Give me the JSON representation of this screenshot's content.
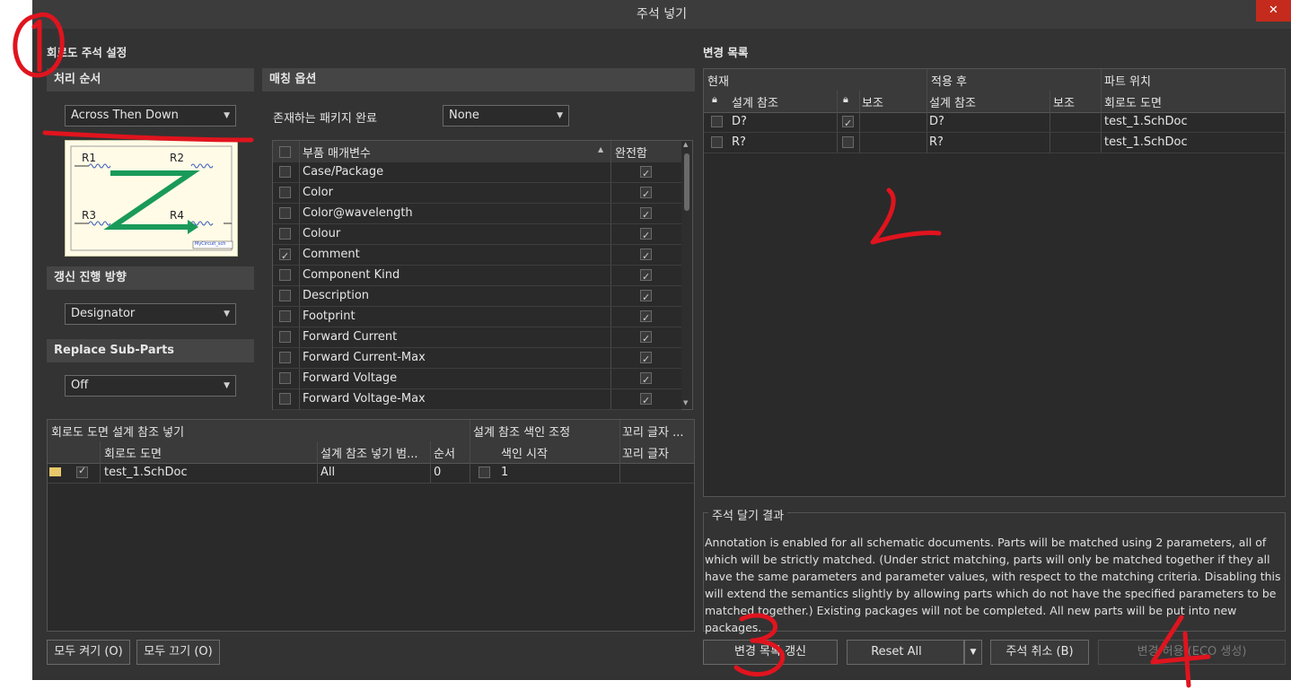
{
  "window": {
    "title": "주석 넣기",
    "close": "✕"
  },
  "left": {
    "section_title": "회로도 주석 설정",
    "order": {
      "header": "처리 순서",
      "selected": "Across Then Down"
    },
    "preview": {
      "r1": "R1",
      "r2": "R2",
      "r3": "R3",
      "r4": "R4",
      "caption": "MyCircuit_sch"
    },
    "direction": {
      "header": "갱신 진행 방향",
      "selected": "Designator"
    },
    "subparts": {
      "header": "Replace Sub-Parts",
      "selected": "Off"
    },
    "matching": {
      "header": "매칭 옵션",
      "complete_label": "존재하는 패키지 완료",
      "complete_value": "None",
      "col_param": "부품 매개변수",
      "col_strict": "완전함",
      "params": [
        {
          "name": "Case/Package",
          "checked": false
        },
        {
          "name": "Color",
          "checked": false
        },
        {
          "name": "Color@wavelength",
          "checked": false
        },
        {
          "name": "Colour",
          "checked": false
        },
        {
          "name": "Comment",
          "checked": true
        },
        {
          "name": "Component Kind",
          "checked": false
        },
        {
          "name": "Description",
          "checked": false
        },
        {
          "name": "Footprint",
          "checked": false
        },
        {
          "name": "Forward Current",
          "checked": false
        },
        {
          "name": "Forward Current-Max",
          "checked": false
        },
        {
          "name": "Forward Voltage",
          "checked": false
        },
        {
          "name": "Forward Voltage-Max",
          "checked": false
        }
      ]
    },
    "sheets": {
      "grp1": "회로도 도면 설계 참조 넣기",
      "grp2": "설계 참조 색인 조정",
      "grp3": "꼬리 글자 ...",
      "col_sheet": "회로도 도면",
      "col_range": "설계 참조 넣기 범...",
      "col_order": "순서",
      "col_start": "색인 시작",
      "col_suffix": "꼬리 글자",
      "row": {
        "sheet": "test_1.SchDoc",
        "range": "All",
        "order": "0",
        "start": "1"
      }
    },
    "buttons": {
      "all_on": "모두 켜기 (O)",
      "all_off": "모두 끄기 (O)"
    }
  },
  "right": {
    "section_title": "변경 목록",
    "table": {
      "grp_current": "현재",
      "grp_after": "적용 후",
      "grp_location": "파트 위치",
      "col_designator": "설계 참조",
      "col_sub": "보조",
      "col_designator2": "설계 참조",
      "col_sub2": "보조",
      "col_sheet": "회로도 도면",
      "rows": [
        {
          "cur": "D?",
          "after": "D?",
          "sheet": "test_1.SchDoc"
        },
        {
          "cur": "R?",
          "after": "R?",
          "sheet": "test_1.SchDoc"
        }
      ]
    },
    "result": {
      "title": "주석 달기 결과",
      "text": "Annotation is enabled for all schematic documents. Parts will be matched using 2 parameters, all of which will be strictly matched. (Under strict matching, parts will only be matched together if they all have the same parameters and parameter values, with respect to the matching criteria. Disabling this will extend the semantics slightly by allowing parts which do not have the specified parameters to be matched together.) Existing packages will not be completed. All new parts will be put into new packages."
    },
    "buttons": {
      "update": "변경 목록 갱신",
      "reset": "Reset All",
      "undo": "주석 취소 (B)",
      "accept": "변경 허용 (ECO 생성)"
    }
  },
  "annotations": {
    "n1": "1",
    "n2": "2",
    "n3": "3",
    "n4": "4"
  },
  "colors": {
    "bg": "#333333",
    "header": "#454545",
    "annot": "#e0141e",
    "arrow": "#1a9a5a"
  }
}
